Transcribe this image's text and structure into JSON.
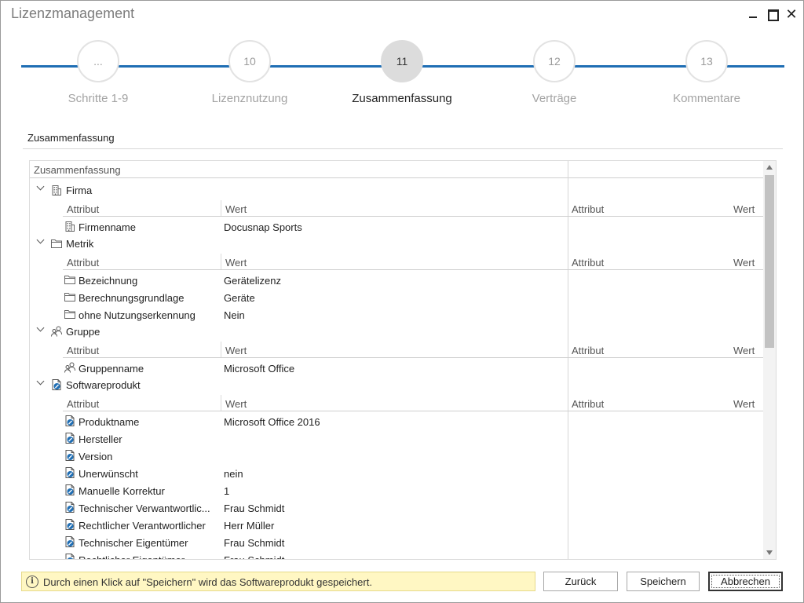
{
  "window": {
    "title": "Lizenzmanagement",
    "close_glyph": "✕"
  },
  "stepper": {
    "active_index": 2,
    "steps": [
      {
        "number": "...",
        "label": "Schritte 1-9"
      },
      {
        "number": "10",
        "label": "Lizenznutzung"
      },
      {
        "number": "11",
        "label": "Zusammenfassung"
      },
      {
        "number": "12",
        "label": "Verträge"
      },
      {
        "number": "13",
        "label": "Kommentare"
      }
    ]
  },
  "section": {
    "title": "Zusammenfassung"
  },
  "grid": {
    "header": "Zusammenfassung",
    "subheader": {
      "attr": "Attribut",
      "value": "Wert"
    },
    "groups": [
      {
        "name": "Firma",
        "icon": "building-icon",
        "rows": [
          {
            "attr": "Firmenname",
            "value": "Docusnap Sports",
            "icon": "building-icon"
          }
        ]
      },
      {
        "name": "Metrik",
        "icon": "folder-icon",
        "rows": [
          {
            "attr": "Bezeichnung",
            "value": "Gerätelizenz",
            "icon": "folder-icon"
          },
          {
            "attr": "Berechnungsgrundlage",
            "value": "Geräte",
            "icon": "folder-icon"
          },
          {
            "attr": "ohne Nutzungserkennung",
            "value": "Nein",
            "icon": "folder-icon"
          }
        ]
      },
      {
        "name": "Gruppe",
        "icon": "users-icon",
        "rows": [
          {
            "attr": "Gruppenname",
            "value": "Microsoft Office",
            "icon": "users-icon"
          }
        ]
      },
      {
        "name": "Softwareprodukt",
        "icon": "software-product-icon",
        "rows": [
          {
            "attr": "Produktname",
            "value": "Microsoft Office 2016",
            "icon": "software-product-icon"
          },
          {
            "attr": "Hersteller",
            "value": "",
            "icon": "software-product-icon"
          },
          {
            "attr": "Version",
            "value": "",
            "icon": "software-product-icon"
          },
          {
            "attr": "Unerwünscht",
            "value": "nein",
            "icon": "software-product-icon"
          },
          {
            "attr": "Manuelle Korrektur",
            "value": "1",
            "icon": "software-product-icon"
          },
          {
            "attr": "Technischer Verwantwortlic...",
            "value": "Frau Schmidt",
            "icon": "software-product-icon"
          },
          {
            "attr": "Rechtlicher Verantwortlicher",
            "value": "Herr Müller",
            "icon": "software-product-icon"
          },
          {
            "attr": "Technischer Eigentümer",
            "value": "Frau Schmidt",
            "icon": "software-product-icon"
          },
          {
            "attr": "Rechtlicher Eigentümer",
            "value": "Frau Schmidt",
            "icon": "software-product-icon"
          }
        ]
      }
    ]
  },
  "footer": {
    "info_glyph": "i",
    "info_text": "Durch einen Klick auf \"Speichern\" wird das Softwareprodukt gespeichert.",
    "back_label": "Zurück",
    "save_label": "Speichern",
    "cancel_label": "Abbrechen"
  }
}
